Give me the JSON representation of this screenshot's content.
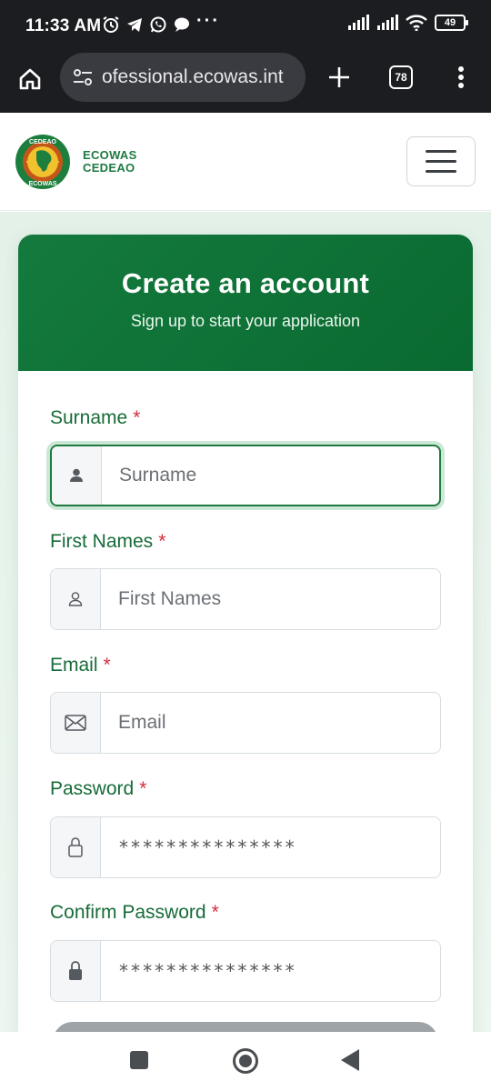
{
  "status_bar": {
    "time": "11:33 AM",
    "battery": "49",
    "icons": [
      "alarm-icon",
      "telegram-icon",
      "whatsapp-icon",
      "chat-bubble-icon",
      "more-dots-icon",
      "signal-icon",
      "signal-icon",
      "wifi-icon",
      "battery-icon"
    ]
  },
  "browser": {
    "url": "ofessional.ecowas.int",
    "tab_count": "78",
    "icons": [
      "home-icon",
      "site-settings-icon",
      "plus-icon",
      "tabs-icon",
      "overflow-menu-icon"
    ]
  },
  "header": {
    "brand_line1": "ECOWAS",
    "brand_line2": "CEDEAO",
    "logo_text_top": "CEDEAO",
    "logo_text_bottom": "ECOWAS"
  },
  "form": {
    "title": "Create an account",
    "subtitle": "Sign up to start your application",
    "required_mark": "*",
    "fields": {
      "surname": {
        "label": "Surname",
        "placeholder": "Surname",
        "icon": "person-filled-icon"
      },
      "first_names": {
        "label": "First Names",
        "placeholder": "First Names",
        "icon": "person-outline-icon"
      },
      "email": {
        "label": "Email",
        "placeholder": "Email",
        "icon": "envelope-icon"
      },
      "password": {
        "label": "Password",
        "value": "***************",
        "icon": "lock-outline-icon"
      },
      "confirm_password": {
        "label": "Confirm Password",
        "value": "***************",
        "icon": "lock-filled-icon"
      }
    }
  },
  "colors": {
    "brand_green": "#147a3d",
    "label_green": "#176b38",
    "required_red": "#d22d3d",
    "status_bar": "#1c1d21"
  },
  "nav_bar": {
    "icons": [
      "recents-square-icon",
      "home-circle-icon",
      "back-triangle-icon"
    ]
  }
}
